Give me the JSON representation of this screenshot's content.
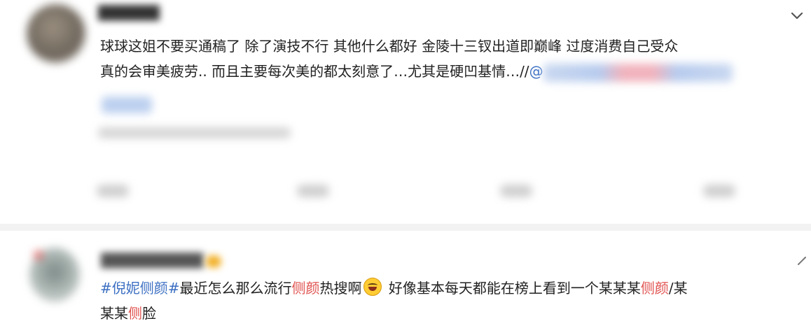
{
  "post1": {
    "username": "██████",
    "line1": "球球这姐不要买通稿了 除了演技不行 其他什么都好 金陵十三钗出道即巅峰 过度消费自己受众",
    "line2": "真的会审美疲劳.. 而且主要每次美的都太刻意了…尤其是硬凹基情…//",
    "link_prefix": "@"
  },
  "post2": {
    "username": "██████████",
    "hashtag": "#倪妮侧颜#",
    "text_a": "最近怎么那么流行",
    "hl1": "侧颜",
    "text_b": "热搜啊",
    "text_c": " 好像基本每天都能在榜上看到一个某某某",
    "hl2": "侧颜",
    "text_d": "/某",
    "line2_a": "某某",
    "hl3": "侧",
    "line2_b": "脸"
  },
  "icons": {
    "chevron": "chevron-down-icon",
    "emoji": "laughing-tears-emoji-icon",
    "edit": "pencil-corner-icon"
  },
  "colors": {
    "hashtag": "#3c6fc2",
    "highlight": "#e0524f",
    "text": "#222222"
  }
}
